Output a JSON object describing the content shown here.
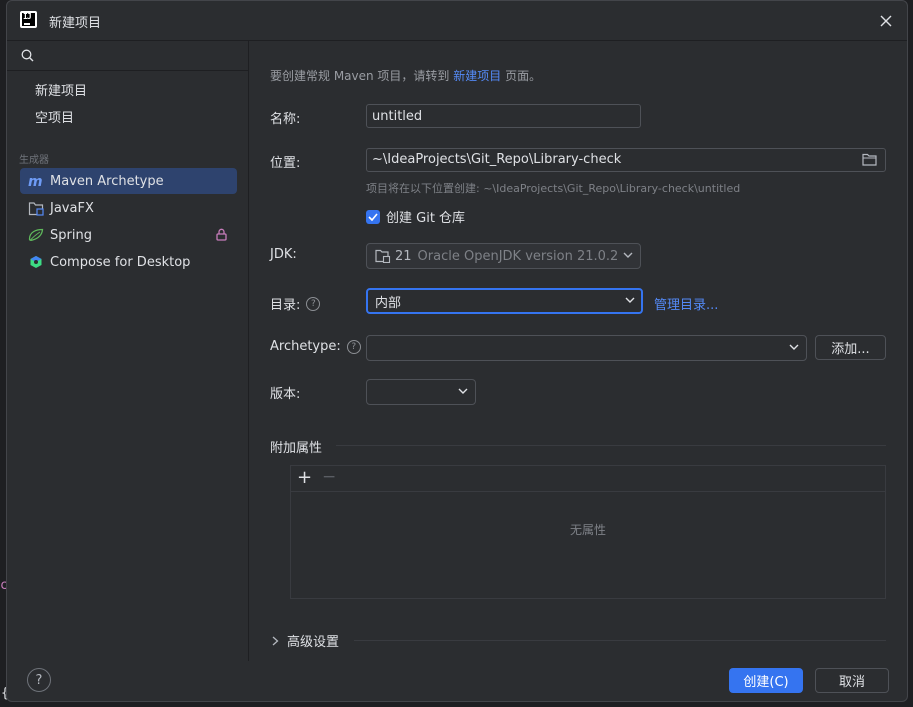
{
  "window": {
    "title": "新建项目"
  },
  "sidebar": {
    "search_placeholder": "",
    "top_items": [
      {
        "label": "新建项目"
      },
      {
        "label": "空项目"
      }
    ],
    "section_label": "生成器",
    "generators": [
      {
        "label": "Maven Archetype",
        "icon": "maven-icon",
        "selected": true
      },
      {
        "label": "JavaFX",
        "icon": "javafx-icon",
        "selected": false
      },
      {
        "label": "Spring",
        "icon": "spring-icon",
        "selected": false,
        "locked": true
      },
      {
        "label": "Compose for Desktop",
        "icon": "compose-icon",
        "selected": false
      }
    ]
  },
  "form": {
    "hint_prefix": "要创建常规 Maven 项目，请转到 ",
    "hint_link": "新建项目",
    "hint_suffix": " 页面。",
    "name_label": "名称:",
    "name_value": "untitled",
    "location_label": "位置:",
    "location_value": "~\\IdeaProjects\\Git_Repo\\Library-check",
    "location_note": "项目将在以下位置创建: ~\\IdeaProjects\\Git_Repo\\Library-check\\untitled",
    "git_label": "创建 Git 仓库",
    "git_checked": true,
    "jdk_label": "JDK:",
    "jdk_version": "21",
    "jdk_detail": "Oracle OpenJDK version 21.0.2",
    "catalog_label": "目录:",
    "catalog_value": "内部",
    "manage_catalog_link": "管理目录...",
    "archetype_label": "Archetype:",
    "archetype_value": "",
    "add_button": "添加...",
    "version_label": "版本:",
    "version_value": "",
    "extra_props_label": "附加属性",
    "add_prop_symbol": "+",
    "remove_prop_symbol": "−",
    "no_props_text": "无属性",
    "advanced_label": "高级设置"
  },
  "footer": {
    "help_symbol": "?",
    "create_button": "创建(C)",
    "cancel_button": "取消"
  },
  "background": {
    "c_glyph": "c",
    "brace_glyph": "{"
  },
  "colors": {
    "accent": "#3574f0",
    "selection": "#2e436e",
    "link": "#548af7",
    "panel": "#2b2d30"
  }
}
